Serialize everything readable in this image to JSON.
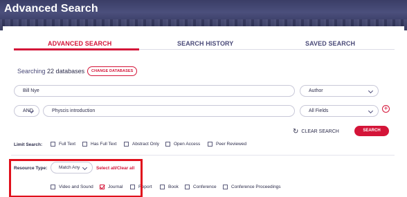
{
  "header": {
    "title": "Advanced Search"
  },
  "tabs": [
    {
      "label": "ADVANCED SEARCH",
      "active": true
    },
    {
      "label": "SEARCH HISTORY",
      "active": false
    },
    {
      "label": "SAVED SEARCH",
      "active": false
    }
  ],
  "databases": {
    "prefix": "Searching",
    "count": "22 databases",
    "change_label": "CHANGE DATABASES"
  },
  "rows": [
    {
      "query": "Bill Nye",
      "field": "Author"
    },
    {
      "operator": "AND",
      "query": "Physcis introduction",
      "field": "All Fields"
    }
  ],
  "actions": {
    "clear_label": "CLEAR SEARCH",
    "search_label": "SEARCH",
    "add_icon": "plus-circle-icon",
    "clear_icon": "refresh-icon"
  },
  "limit": {
    "label": "Limit Search:",
    "options": [
      {
        "label": "Full Text",
        "checked": false
      },
      {
        "label": "Has Full Text",
        "checked": false
      },
      {
        "label": "Abstract Only",
        "checked": false
      },
      {
        "label": "Open Access",
        "checked": false
      },
      {
        "label": "Peer Reviewed",
        "checked": false
      }
    ]
  },
  "resource": {
    "label": "Resource Type:",
    "match": "Match Any",
    "select_all": "Select all/Clear all",
    "options": [
      {
        "label": "Video and Sound",
        "checked": false
      },
      {
        "label": "Journal",
        "checked": true
      },
      {
        "label": "Report",
        "checked": false
      },
      {
        "label": "Book",
        "checked": false
      },
      {
        "label": "Conference",
        "checked": false
      },
      {
        "label": "Conference Proceedings",
        "checked": false
      }
    ]
  },
  "colors": {
    "accent": "#d41438",
    "text": "#2b2b4a",
    "annotation": "#e0101c"
  }
}
